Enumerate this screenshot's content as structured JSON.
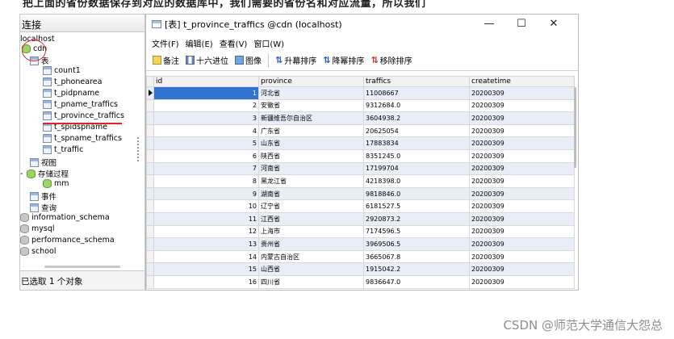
{
  "top_caption": "把上面的省份数据保存到对应的数据库中，我们需要的省份名和对应流量，所以我们",
  "left_panel": {
    "header": "连接",
    "tree": {
      "localhost": "localhost",
      "cdn": "cdn",
      "tables_folder": "表",
      "tables": [
        "count1",
        "t_phonearea",
        "t_pidpname",
        "t_pname_traffics",
        "t_province_traffics",
        "t_spidspname",
        "t_spname_traffics",
        "t_traffic"
      ],
      "views": "视图",
      "procedures": "存储过程",
      "procedure_items": [
        "mm"
      ],
      "events": "事件",
      "queries": "查询",
      "other_dbs": [
        "information_schema",
        "mysql",
        "performance_schema",
        "school"
      ]
    },
    "status": "已选取 1 个对象"
  },
  "window": {
    "title": "[表] t_province_traffics @cdn (localhost)",
    "buttons": {
      "minimize": "—",
      "maximize": "☐",
      "close": "✕"
    },
    "menu": [
      "文件(F)",
      "编辑(E)",
      "查看(V)",
      "窗口(W)"
    ],
    "toolbar": {
      "note": "备注",
      "hex": "十六进位",
      "image": "图像",
      "sort_asc": "升幕排序",
      "sort_desc": "降幂排序",
      "remove_sort": "移除排序"
    }
  },
  "grid": {
    "columns": [
      "id",
      "province",
      "traffics",
      "createtime"
    ],
    "rows": [
      {
        "id": "1",
        "province": "河北省",
        "traffics": "11008667",
        "createtime": "20200309"
      },
      {
        "id": "2",
        "province": "安徽省",
        "traffics": "9312684.0",
        "createtime": "20200309"
      },
      {
        "id": "3",
        "province": "新疆维吾尔自治区",
        "traffics": "3604938.2",
        "createtime": "20200309"
      },
      {
        "id": "4",
        "province": "广东省",
        "traffics": "20625054",
        "createtime": "20200309"
      },
      {
        "id": "5",
        "province": "山东省",
        "traffics": "17883834",
        "createtime": "20200309"
      },
      {
        "id": "6",
        "province": "陕西省",
        "traffics": "8351245.0",
        "createtime": "20200309"
      },
      {
        "id": "7",
        "province": "河南省",
        "traffics": "17199704",
        "createtime": "20200309"
      },
      {
        "id": "8",
        "province": "黑龙江省",
        "traffics": "4218398.0",
        "createtime": "20200309"
      },
      {
        "id": "9",
        "province": "湖南省",
        "traffics": "9818846.0",
        "createtime": "20200309"
      },
      {
        "id": "10",
        "province": "辽宁省",
        "traffics": "6181527.5",
        "createtime": "20200309"
      },
      {
        "id": "11",
        "province": "江西省",
        "traffics": "2920873.2",
        "createtime": "20200309"
      },
      {
        "id": "12",
        "province": "上海市",
        "traffics": "7174596.5",
        "createtime": "20200309"
      },
      {
        "id": "13",
        "province": "贵州省",
        "traffics": "3969506.5",
        "createtime": "20200309"
      },
      {
        "id": "14",
        "province": "内蒙古自治区",
        "traffics": "3665067.8",
        "createtime": "20200309"
      },
      {
        "id": "15",
        "province": "山西省",
        "traffics": "1915042.2",
        "createtime": "20200309"
      },
      {
        "id": "16",
        "province": "四川省",
        "traffics": "9836647.0",
        "createtime": "20200309"
      }
    ]
  },
  "watermark": "CSDN @师范大学通信大怨总",
  "colors": {
    "selection": "#2f73cf",
    "alt_row": "#e7eef8",
    "annotation": "#e0202a"
  }
}
